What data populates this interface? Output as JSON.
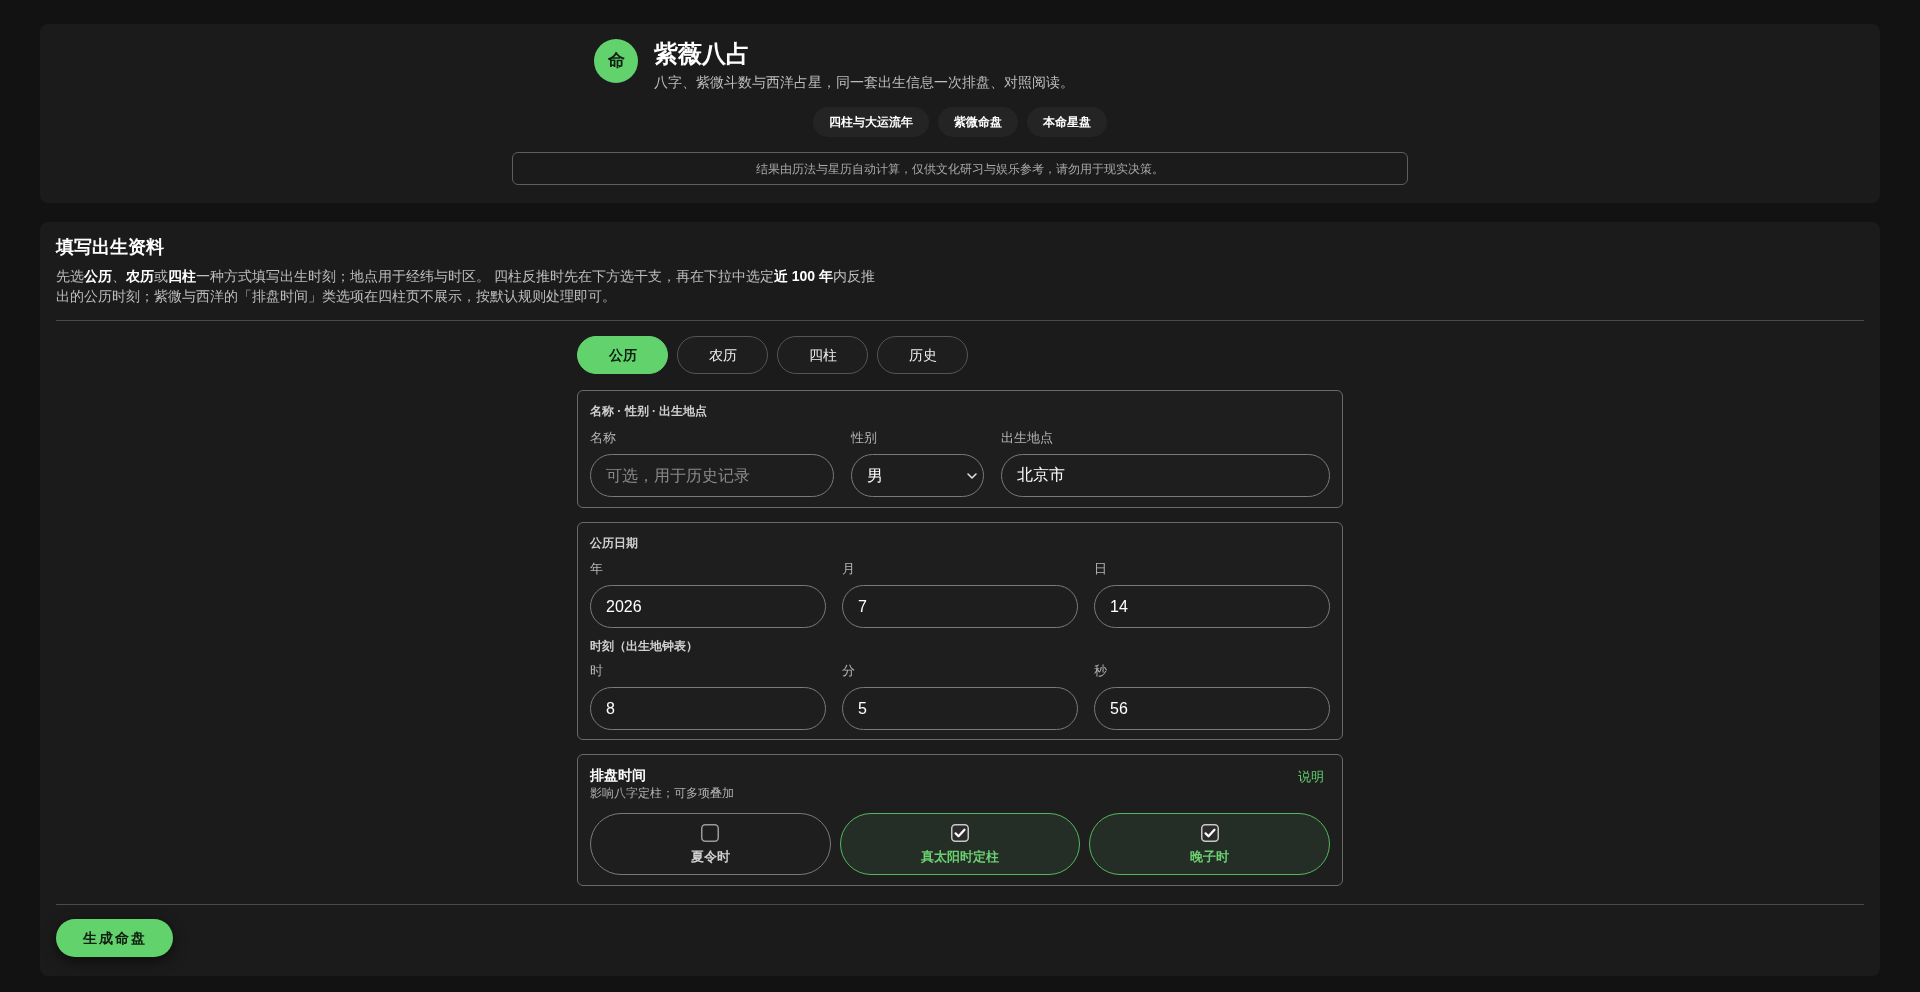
{
  "header": {
    "logo_text": "命",
    "title": "紫薇八占",
    "subtitle": "八字、紫微斗数与西洋占星，同一套出生信息一次排盘、对照阅读。",
    "features": [
      "四柱与大运流年",
      "紫微命盘",
      "本命星盘"
    ],
    "notice": "结果由历法与星历自动计算，仅供文化研习与娱乐参考，请勿用于现实决策。"
  },
  "form": {
    "title": "填写出生资料",
    "description": "先选**公历**、**农历**或**四柱**一种方式填写出生时刻；地点用于经纬与时区。 四柱反推时先在下方选干支，再在下拉中选定**近 100 年**内反推出的公历时刻；紫微与西洋的「排盘时间」类选项在四柱页不展示，按默认规则处理即可。",
    "tabs": [
      {
        "label": "公历",
        "selected": true
      },
      {
        "label": "农历",
        "selected": false
      },
      {
        "label": "四柱",
        "selected": false
      },
      {
        "label": "历史",
        "selected": false
      }
    ],
    "identity": {
      "title": "名称 · 性别 · 出生地点",
      "fields": [
        {
          "kind": "input",
          "label": "名称",
          "placeholder": "可选，用于历史记录"
        },
        {
          "kind": "select",
          "label": "性别",
          "value": "男"
        },
        {
          "kind": "input",
          "label": "出生地点",
          "value": "北京市"
        }
      ]
    },
    "date": {
      "title": "公历日期",
      "fields": [
        {
          "label": "年",
          "value": "2026"
        },
        {
          "label": "月",
          "value": "7"
        },
        {
          "label": "日",
          "value": "14"
        }
      ]
    },
    "time": {
      "title": "时刻（出生地钟表）",
      "fields": [
        {
          "label": "时",
          "value": "8"
        },
        {
          "label": "分",
          "value": "5"
        },
        {
          "label": "秒",
          "value": "56"
        }
      ]
    },
    "timing": {
      "title": "排盘时间",
      "help_link": "说明",
      "subtitle": "影响八字定柱；可多项叠加",
      "options": [
        {
          "label": "夏令时",
          "checked": false
        },
        {
          "label": "真太阳时定柱",
          "checked": true
        },
        {
          "label": "晚子时",
          "checked": true
        }
      ]
    },
    "submit": "生成命盘"
  }
}
